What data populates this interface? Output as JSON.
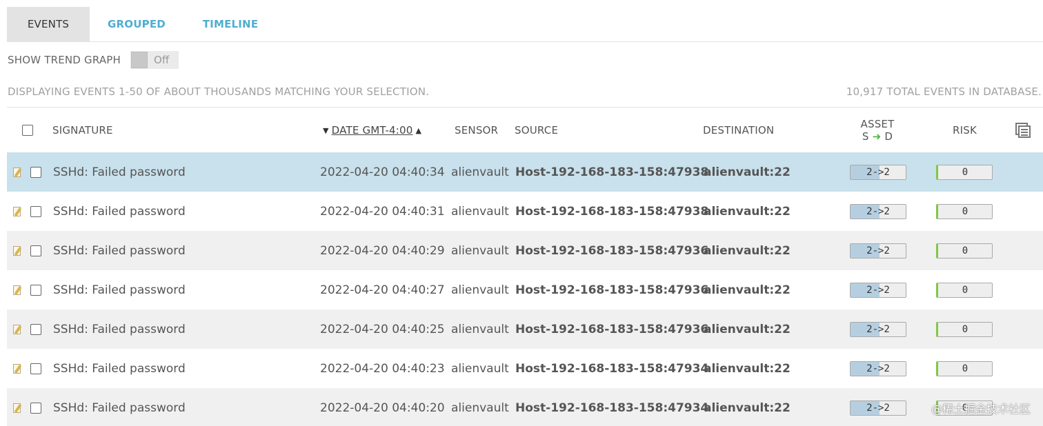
{
  "tabs": [
    {
      "label": "EVENTS",
      "active": true
    },
    {
      "label": "GROUPED",
      "active": false
    },
    {
      "label": "TIMELINE",
      "active": false
    }
  ],
  "trend": {
    "label": "SHOW TREND GRAPH",
    "toggle_text": "Off",
    "enabled": false
  },
  "summary": {
    "left": "DISPLAYING EVENTS 1-50 OF ABOUT THOUSANDS MATCHING YOUR SELECTION.",
    "right": "10,917 TOTAL EVENTS IN DATABASE."
  },
  "columns": {
    "signature": "SIGNATURE",
    "date": "DATE GMT-4:00",
    "sensor": "SENSOR",
    "source": "SOURCE",
    "destination": "DESTINATION",
    "asset_top": "ASSET",
    "asset_s": "S",
    "asset_arrow": "➜",
    "asset_d": "D",
    "risk": "RISK"
  },
  "colors": {
    "accent": "#4eaed0",
    "selected_row": "#c8e1ec",
    "alt_row": "#f0f0f0",
    "risk_bar": "#7fc843"
  },
  "events": [
    {
      "signature": "SSHd: Failed password",
      "date": "2022-04-20 04:40:34",
      "sensor": "alienvault",
      "source": "Host-192-168-183-158:47938",
      "destination": "alienvault:22",
      "asset": "2->2",
      "risk": "0"
    },
    {
      "signature": "SSHd: Failed password",
      "date": "2022-04-20 04:40:31",
      "sensor": "alienvault",
      "source": "Host-192-168-183-158:47938",
      "destination": "alienvault:22",
      "asset": "2->2",
      "risk": "0"
    },
    {
      "signature": "SSHd: Failed password",
      "date": "2022-04-20 04:40:29",
      "sensor": "alienvault",
      "source": "Host-192-168-183-158:47936",
      "destination": "alienvault:22",
      "asset": "2->2",
      "risk": "0"
    },
    {
      "signature": "SSHd: Failed password",
      "date": "2022-04-20 04:40:27",
      "sensor": "alienvault",
      "source": "Host-192-168-183-158:47936",
      "destination": "alienvault:22",
      "asset": "2->2",
      "risk": "0"
    },
    {
      "signature": "SSHd: Failed password",
      "date": "2022-04-20 04:40:25",
      "sensor": "alienvault",
      "source": "Host-192-168-183-158:47936",
      "destination": "alienvault:22",
      "asset": "2->2",
      "risk": "0"
    },
    {
      "signature": "SSHd: Failed password",
      "date": "2022-04-20 04:40:23",
      "sensor": "alienvault",
      "source": "Host-192-168-183-158:47934",
      "destination": "alienvault:22",
      "asset": "2->2",
      "risk": "0"
    },
    {
      "signature": "SSHd: Failed password",
      "date": "2022-04-20 04:40:20",
      "sensor": "alienvault",
      "source": "Host-192-168-183-158:47934",
      "destination": "alienvault:22",
      "asset": "2->2",
      "risk": "0"
    }
  ],
  "watermark": "@稀土掘金技术社区"
}
